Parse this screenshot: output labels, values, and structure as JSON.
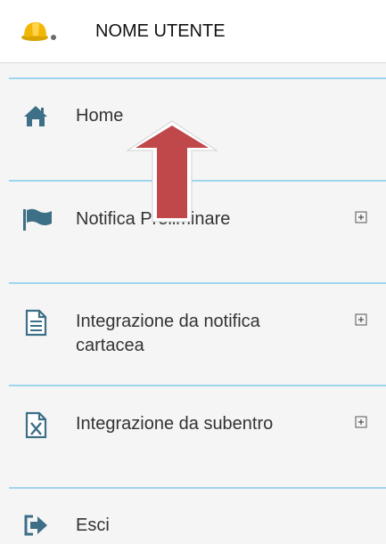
{
  "header": {
    "avatar_icon": "hardhat-user-icon",
    "username": "NOME UTENTE"
  },
  "menu": {
    "items": [
      {
        "icon": "home-icon",
        "label": "Home",
        "expandable": false
      },
      {
        "icon": "flag-icon",
        "label": "Notifica Preliminare",
        "expandable": true
      },
      {
        "icon": "document-icon",
        "label": "Integrazione da notifica\ncartacea",
        "expandable": true
      },
      {
        "icon": "excel-document-icon",
        "label": "Integrazione da subentro",
        "expandable": true
      },
      {
        "icon": "exit-icon",
        "label": "Esci",
        "expandable": false
      }
    ],
    "expand_icon": "plus-box-icon"
  },
  "annotation": {
    "icon": "up-arrow-icon",
    "color": "#c0474a"
  },
  "colors": {
    "accent": "#3d6f86",
    "separator": "#9fd4ee",
    "menu_bg": "#f5f5f5"
  }
}
